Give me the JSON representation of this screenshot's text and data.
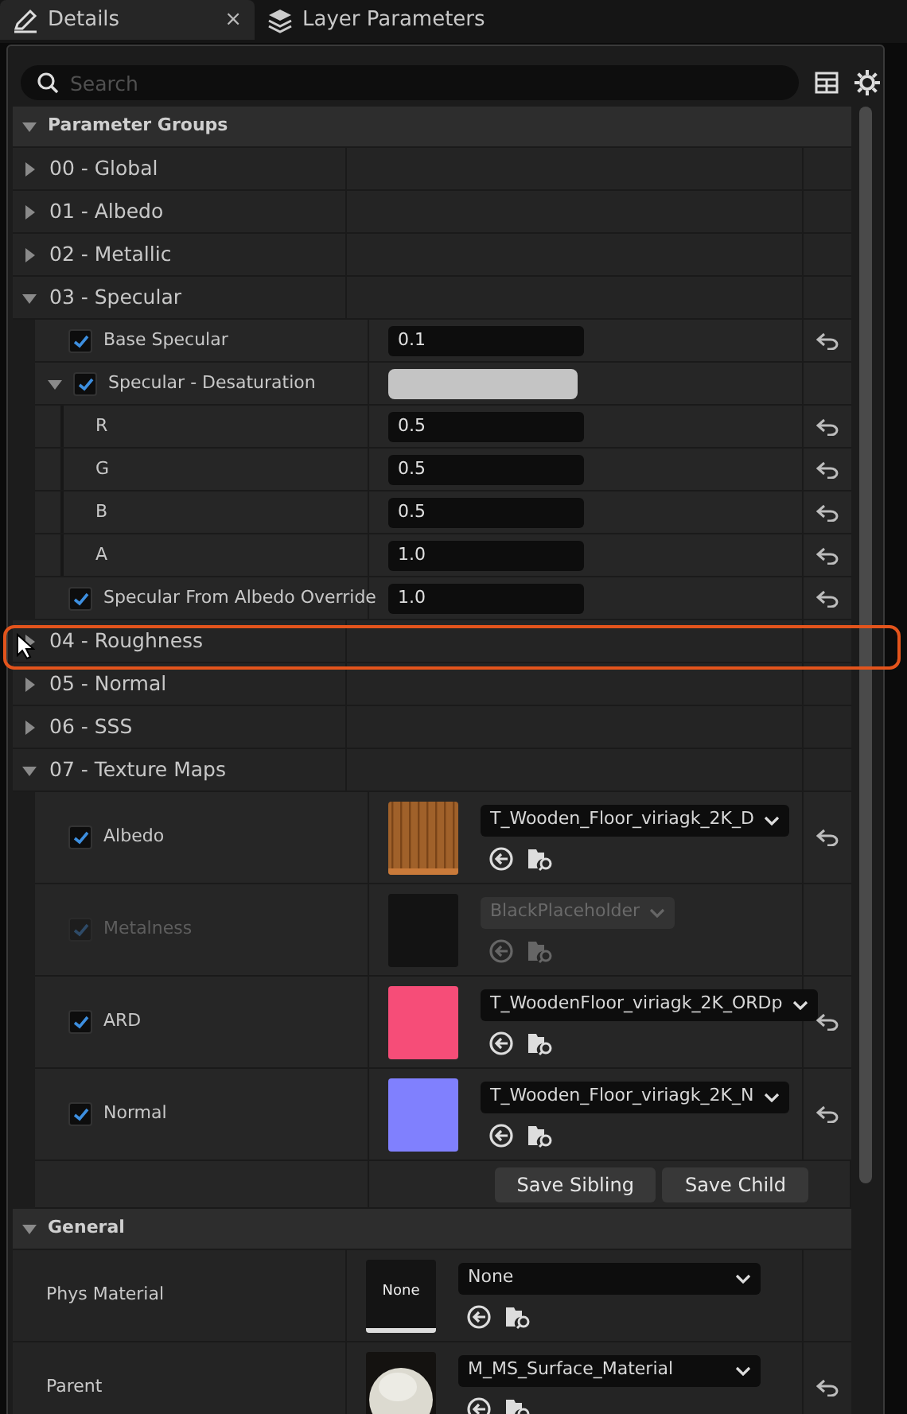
{
  "tabs": [
    {
      "label": "Details",
      "selected": true,
      "close": "×"
    },
    {
      "label": "Layer Parameters",
      "selected": false
    }
  ],
  "search": {
    "placeholder": "Search"
  },
  "sections": [
    {
      "title": "Parameter Groups",
      "expanded": true,
      "groups": [
        {
          "label": "00 - Global",
          "expanded": false
        },
        {
          "label": "01 - Albedo",
          "expanded": false
        },
        {
          "label": "02 - Metallic",
          "expanded": false
        },
        {
          "label": "03 - Specular",
          "expanded": true,
          "params": [
            {
              "kind": "number",
              "label": "Base Specular",
              "checked": true,
              "value": "0.1",
              "reset": true
            },
            {
              "kind": "color",
              "label": "Specular - Desaturation",
              "checked": true,
              "expanded": true,
              "color": "#c4c4c4",
              "reset": false,
              "children": [
                {
                  "kind": "number",
                  "label": "R",
                  "value": "0.5",
                  "reset": true
                },
                {
                  "kind": "number",
                  "label": "G",
                  "value": "0.5",
                  "reset": true
                },
                {
                  "kind": "number",
                  "label": "B",
                  "value": "0.5",
                  "reset": true
                },
                {
                  "kind": "number",
                  "label": "A",
                  "value": "1.0",
                  "reset": true
                }
              ]
            },
            {
              "kind": "number",
              "label": "Specular From Albedo Override",
              "checked": true,
              "value": "1.0",
              "reset": true
            }
          ]
        },
        {
          "label": "04 - Roughness",
          "expanded": false,
          "highlighted": true
        },
        {
          "label": "05 - Normal",
          "expanded": false
        },
        {
          "label": "06 - SSS",
          "expanded": false
        },
        {
          "label": "07 - Texture Maps",
          "expanded": true,
          "params": [
            {
              "kind": "texture",
              "label": "Albedo",
              "checked": true,
              "disabled": false,
              "asset": "T_Wooden_Floor_viriagk_2K_D",
              "reset": true
            },
            {
              "kind": "texture",
              "label": "Metalness",
              "checked": true,
              "disabled": true,
              "thumb": {
                "kind": "color",
                "color": "#131313"
              },
              "asset": "BlackPlaceholder",
              "reset": false
            },
            {
              "kind": "texture",
              "label": "ARD",
              "checked": true,
              "disabled": false,
              "thumb": {
                "kind": "color",
                "color": "#f64d78"
              },
              "asset": "T_WoodenFloor_viriagk_2K_ORDp",
              "reset": true
            },
            {
              "kind": "texture",
              "label": "Normal",
              "checked": true,
              "disabled": false,
              "thumb": {
                "kind": "color",
                "color": "#8080fe"
              },
              "asset": "T_Wooden_Floor_viriagk_2K_N",
              "reset": true
            }
          ],
          "buttons": [
            "Save Sibling",
            "Save Child"
          ]
        }
      ]
    },
    {
      "title": "General",
      "expanded": true,
      "params": [
        {
          "kind": "asset",
          "label": "Phys Material",
          "thumb": {
            "kind": "text",
            "text": "None"
          },
          "asset": "None",
          "reset": false
        },
        {
          "kind": "asset",
          "label": "Parent",
          "asset": "M_MS_Surface_Material",
          "reset": true
        }
      ]
    }
  ]
}
